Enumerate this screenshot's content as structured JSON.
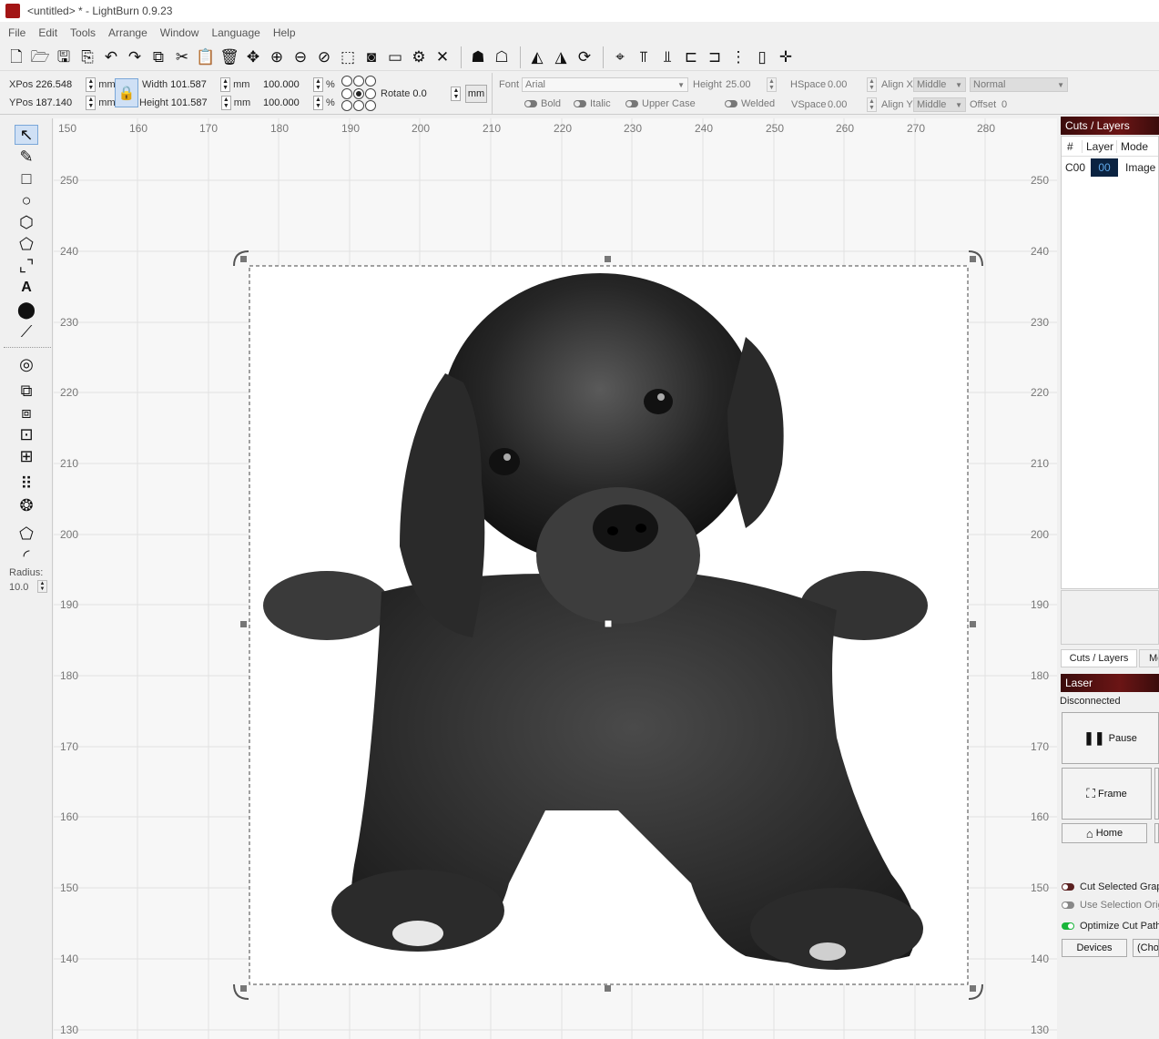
{
  "window": {
    "title": "<untitled> * - LightBurn 0.9.23"
  },
  "menu": [
    "File",
    "Edit",
    "Tools",
    "Arrange",
    "Window",
    "Language",
    "Help"
  ],
  "toolbar_icons": [
    "new-file-icon",
    "open-folder-icon",
    "save-icon",
    "export-icon",
    "undo-icon",
    "redo-icon",
    "copy-icon",
    "cut-icon",
    "paste-icon",
    "delete-icon",
    "move-icon",
    "zoom-in-icon",
    "zoom-out-icon",
    "zoom-fit-icon",
    "frame-select-icon",
    "camera-icon",
    "monitor-icon",
    "settings-icon",
    "tools-icon",
    "group-icon",
    "ungroup-icon",
    "mirror-h-icon",
    "mirror-v-icon",
    "rotate-icon",
    "center-icon",
    "align-top-icon",
    "align-middle-icon",
    "align-left-icon",
    "align-center-icon",
    "distribute-icon",
    "dock-icon",
    "move-laser-icon"
  ],
  "props": {
    "xpos_label": "XPos",
    "xpos": "226.548",
    "ypos_label": "YPos",
    "ypos": "187.140",
    "unit": "mm",
    "width_label": "Width",
    "width": "101.587",
    "height_label": "Height",
    "height": "101.587",
    "width_pct": "100.000",
    "height_pct": "100.000",
    "pct": "%",
    "rotate_label": "Rotate",
    "rotate": "0.0",
    "mm_btn": "mm"
  },
  "font": {
    "font_label": "Font",
    "font_value": "Arial",
    "height_label": "Height",
    "height_value": "25.00",
    "hspace_label": "HSpace",
    "hspace_value": "0.00",
    "vspace_label": "VSpace",
    "vspace_value": "0.00",
    "alignx_label": "Align X",
    "alignx_value": "Middle",
    "aligny_label": "Align Y",
    "aligny_value": "Middle",
    "mode_value": "Normal",
    "offset_label": "Offset",
    "offset_value": "0",
    "bold": "Bold",
    "italic": "Italic",
    "upper": "Upper Case",
    "welded": "Welded"
  },
  "left_tools": [
    "select-icon",
    "pencil-icon",
    "rectangle-icon",
    "ellipse-icon",
    "polygon-icon",
    "edit-nodes-icon",
    "position-icon",
    "text-icon",
    "marker-icon",
    "measure-icon",
    "offset-icon",
    "boolean-union-icon",
    "boolean-diff-icon",
    "boolean-intersect-icon",
    "weld-icon",
    "grid-array-icon",
    "circular-array-icon",
    "corner-icon",
    "round-corner-icon"
  ],
  "radius": {
    "label": "Radius:",
    "value": "10.0"
  },
  "ruler": {
    "x_ticks": [
      "150",
      "160",
      "170",
      "180",
      "190",
      "200",
      "210",
      "220",
      "230",
      "240",
      "250",
      "260",
      "270",
      "280"
    ],
    "y_ticks": [
      "250",
      "240",
      "230",
      "220",
      "210",
      "200",
      "190",
      "180",
      "170",
      "160",
      "150",
      "140",
      "130"
    ]
  },
  "cuts": {
    "title": "Cuts / Layers",
    "cols": [
      "#",
      "Layer",
      "Mode"
    ],
    "row": {
      "num": "C00",
      "layer": "00",
      "mode": "Image"
    },
    "tab1": "Cuts / Layers",
    "tab2": "Mo"
  },
  "laser": {
    "title": "Laser",
    "status": "Disconnected",
    "pause": "Pause",
    "frame": "Frame",
    "home": "Home",
    "cut_selected": "Cut Selected Graphics",
    "use_selection": "Use Selection Origin",
    "optimize": "Optimize Cut Path",
    "devices": "Devices",
    "choose": "(Choose)"
  },
  "colors": {
    "accent": "#5b1010",
    "layer_bg": "#0b2341",
    "layer_fg": "#5fa8e8"
  }
}
